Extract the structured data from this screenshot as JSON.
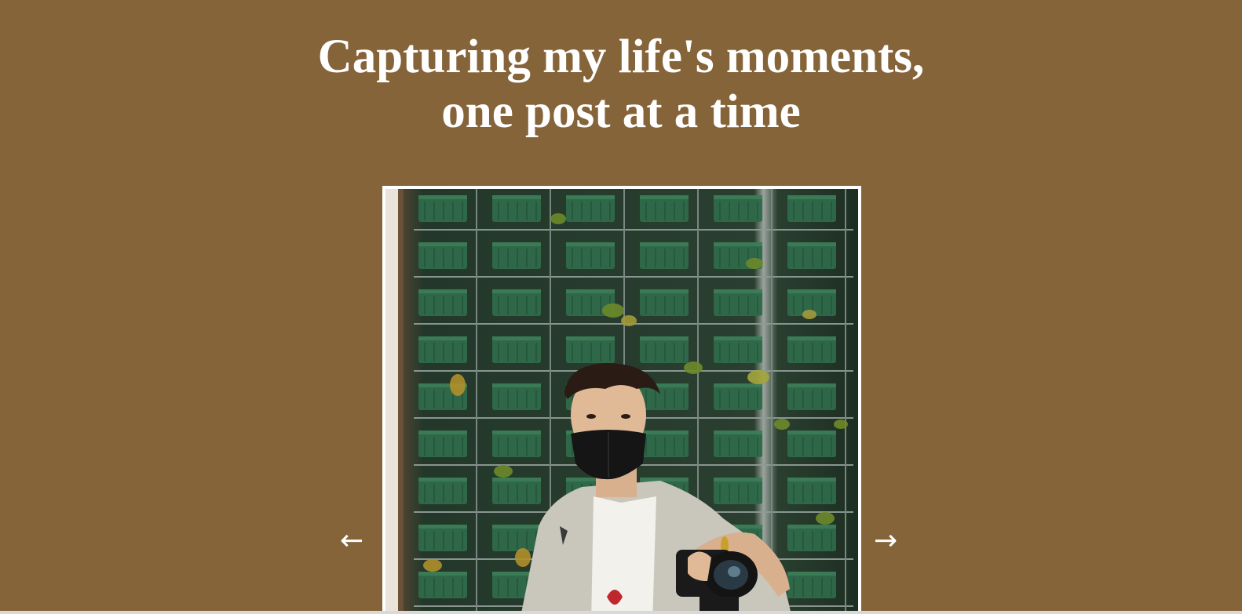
{
  "hero": {
    "headline_line1": "Capturing my life's moments,",
    "headline_line2": "one post at a time"
  },
  "carousel": {
    "prev_label": "←",
    "next_label": "→",
    "image_alt": "Person wearing a black face mask holding a camera in front of a wall of hanging green plant pots"
  },
  "colors": {
    "background": "#86643a",
    "text": "#ffffff",
    "frame_border": "#ffffff"
  }
}
